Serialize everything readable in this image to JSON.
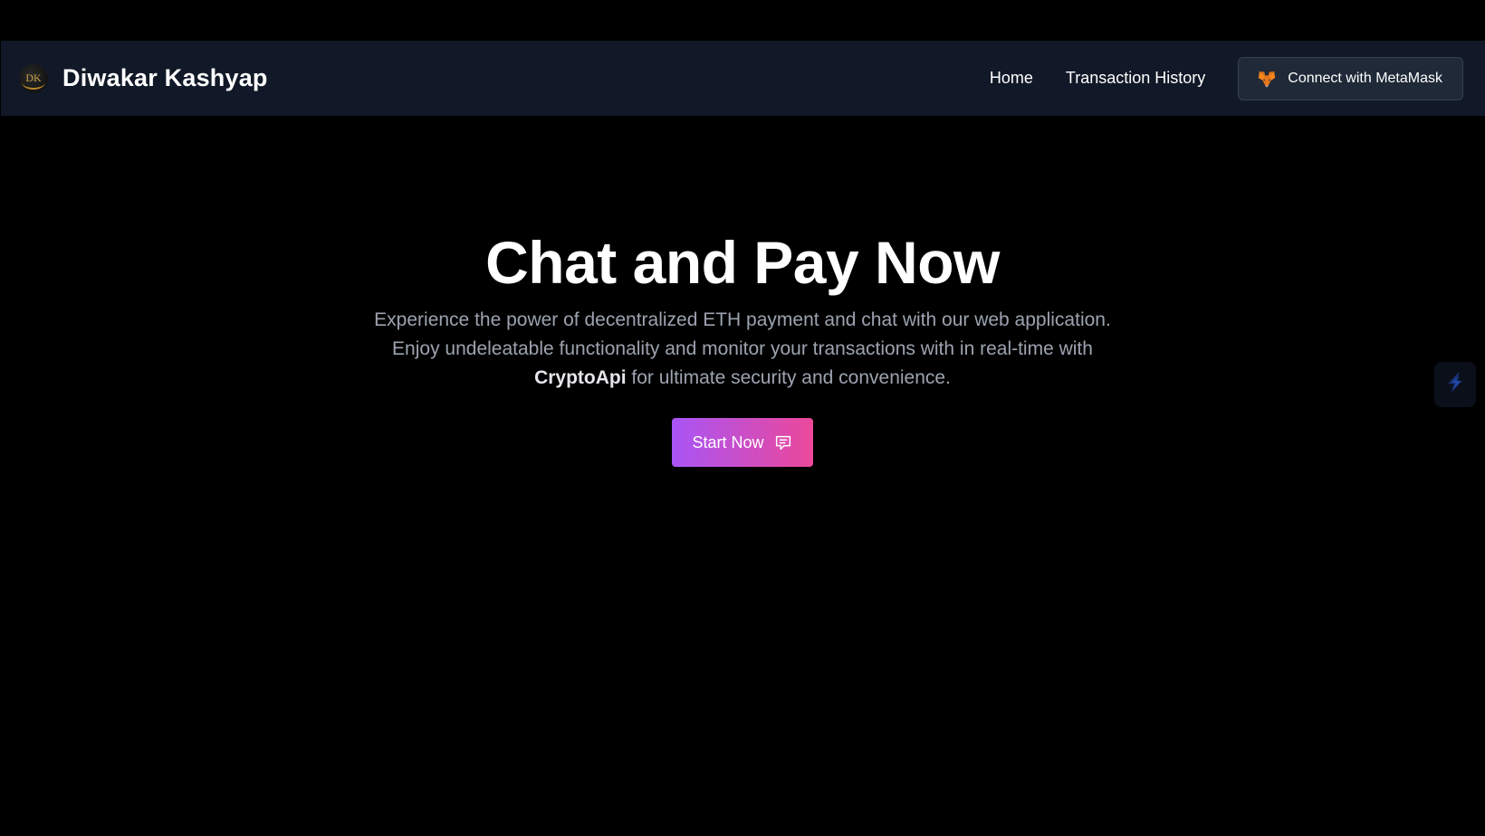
{
  "brand": {
    "logo_text": "DK",
    "name": "Diwakar Kashyap"
  },
  "nav": {
    "home": "Home",
    "transaction_history": "Transaction History",
    "connect_label": "Connect with MetaMask",
    "connect_icon": "metamask-fox-icon"
  },
  "hero": {
    "title": "Chat and Pay Now",
    "desc_before": "Experience the power of decentralized ETH payment and chat with our web application. Enjoy undeleatable functionality and monitor your transactions with in real-time with ",
    "desc_brand": "CryptoApi",
    "desc_after": " for ultimate security and convenience.",
    "cta_label": "Start Now",
    "cta_icon": "chat-bubble-icon"
  },
  "widget": {
    "icon": "lightning-icon"
  },
  "colors": {
    "background": "#000000",
    "navbar": "#111827",
    "button_gradient_start": "#a855f7",
    "button_gradient_end": "#ec4899",
    "muted_text": "#9ca3af"
  }
}
